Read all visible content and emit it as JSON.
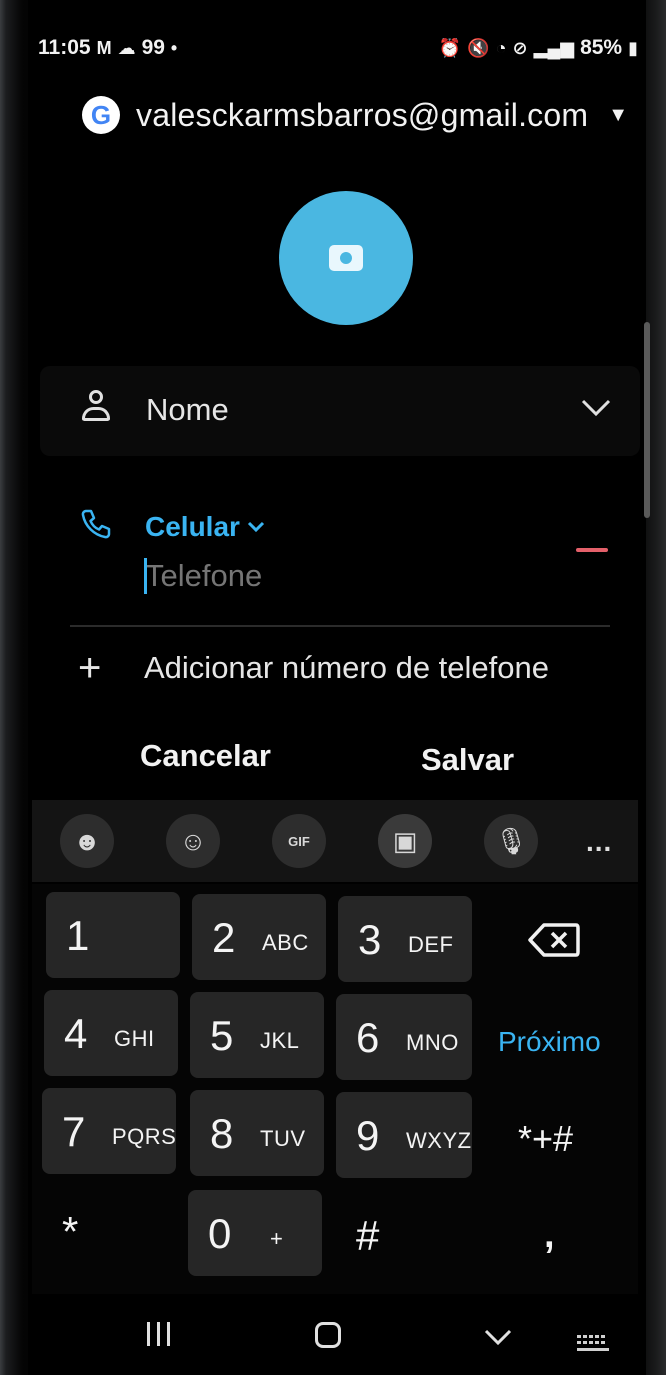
{
  "status_bar": {
    "time": "11:05",
    "notif_count": "99",
    "battery": "85%"
  },
  "account": {
    "email": "valesckarmsbarros@gmail.com",
    "provider_icon": "google-icon"
  },
  "form": {
    "name_placeholder": "Nome",
    "phone_type": "Celular",
    "phone_placeholder": "Telefone",
    "add_phone_label": "Adicionar número de telefone",
    "cancel_label": "Cancelar",
    "save_label": "Salvar"
  },
  "keyboard": {
    "toolbar_icons": [
      "emoji-face-icon",
      "sticker-icon",
      "gif-icon",
      "clipboard-icon",
      "mic-icon",
      "more-icon"
    ],
    "keys": [
      {
        "num": "1",
        "letters": ""
      },
      {
        "num": "2",
        "letters": "ABC"
      },
      {
        "num": "3",
        "letters": "DEF"
      },
      {
        "num": "4",
        "letters": "GHI"
      },
      {
        "num": "5",
        "letters": "JKL"
      },
      {
        "num": "6",
        "letters": "MNO"
      },
      {
        "num": "7",
        "letters": "PQRS"
      },
      {
        "num": "8",
        "letters": "TUV"
      },
      {
        "num": "9",
        "letters": "WXYZ"
      },
      {
        "num": "*",
        "letters": ""
      },
      {
        "num": "0",
        "letters": "+"
      },
      {
        "num": "#",
        "letters": ""
      }
    ],
    "next_label": "Próximo",
    "symbols_label": "*+#",
    "comma_label": ",",
    "more_label": "..."
  },
  "colors": {
    "accent": "#3ab4f2",
    "photo": "#4ab7e1",
    "remove": "#e4606a"
  }
}
